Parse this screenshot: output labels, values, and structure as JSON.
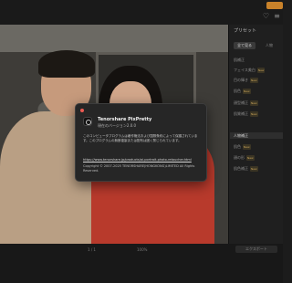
{
  "dialog": {
    "app_name": "Tenorshare PixPretty",
    "version": "現在のバージョン2.0.0",
    "body": "このコンピュータプログラムは著作権法および国際条約によって保護されています。このプログラムの無断複製または配布は固く禁じられています。",
    "link": "https://www.tenorshare.jp/products/ai-portrait-photo-retoucher.html",
    "copyright": "Copyright © 2007-2025 TENORSHARE(HONGKONG)LIMITED All Rights Reserved."
  },
  "panel": {
    "title": "プリセット",
    "tabs": [
      "全て見る",
      "人物"
    ],
    "items": [
      {
        "label": "肌補正",
        "new": false
      },
      {
        "label": "フェイス美白",
        "new": true
      },
      {
        "label": "目の輝き",
        "new": true
      },
      {
        "label": "肌色",
        "new": true
      },
      {
        "label": "顔型補正",
        "new": true
      },
      {
        "label": "肌質補正",
        "new": true
      },
      {
        "label": "人物補正",
        "new": false
      },
      {
        "label": "肌色",
        "new": true
      },
      {
        "label": "顔の形",
        "new": true
      },
      {
        "label": "肌色補正",
        "new": true
      }
    ],
    "new_badge": "New"
  },
  "bottombar": {
    "zoom_text": "100%",
    "page_text": "1 / 1",
    "button_label": "エクスポート"
  },
  "colors": {
    "accent": "#c9822a",
    "close": "#ed5a52"
  }
}
